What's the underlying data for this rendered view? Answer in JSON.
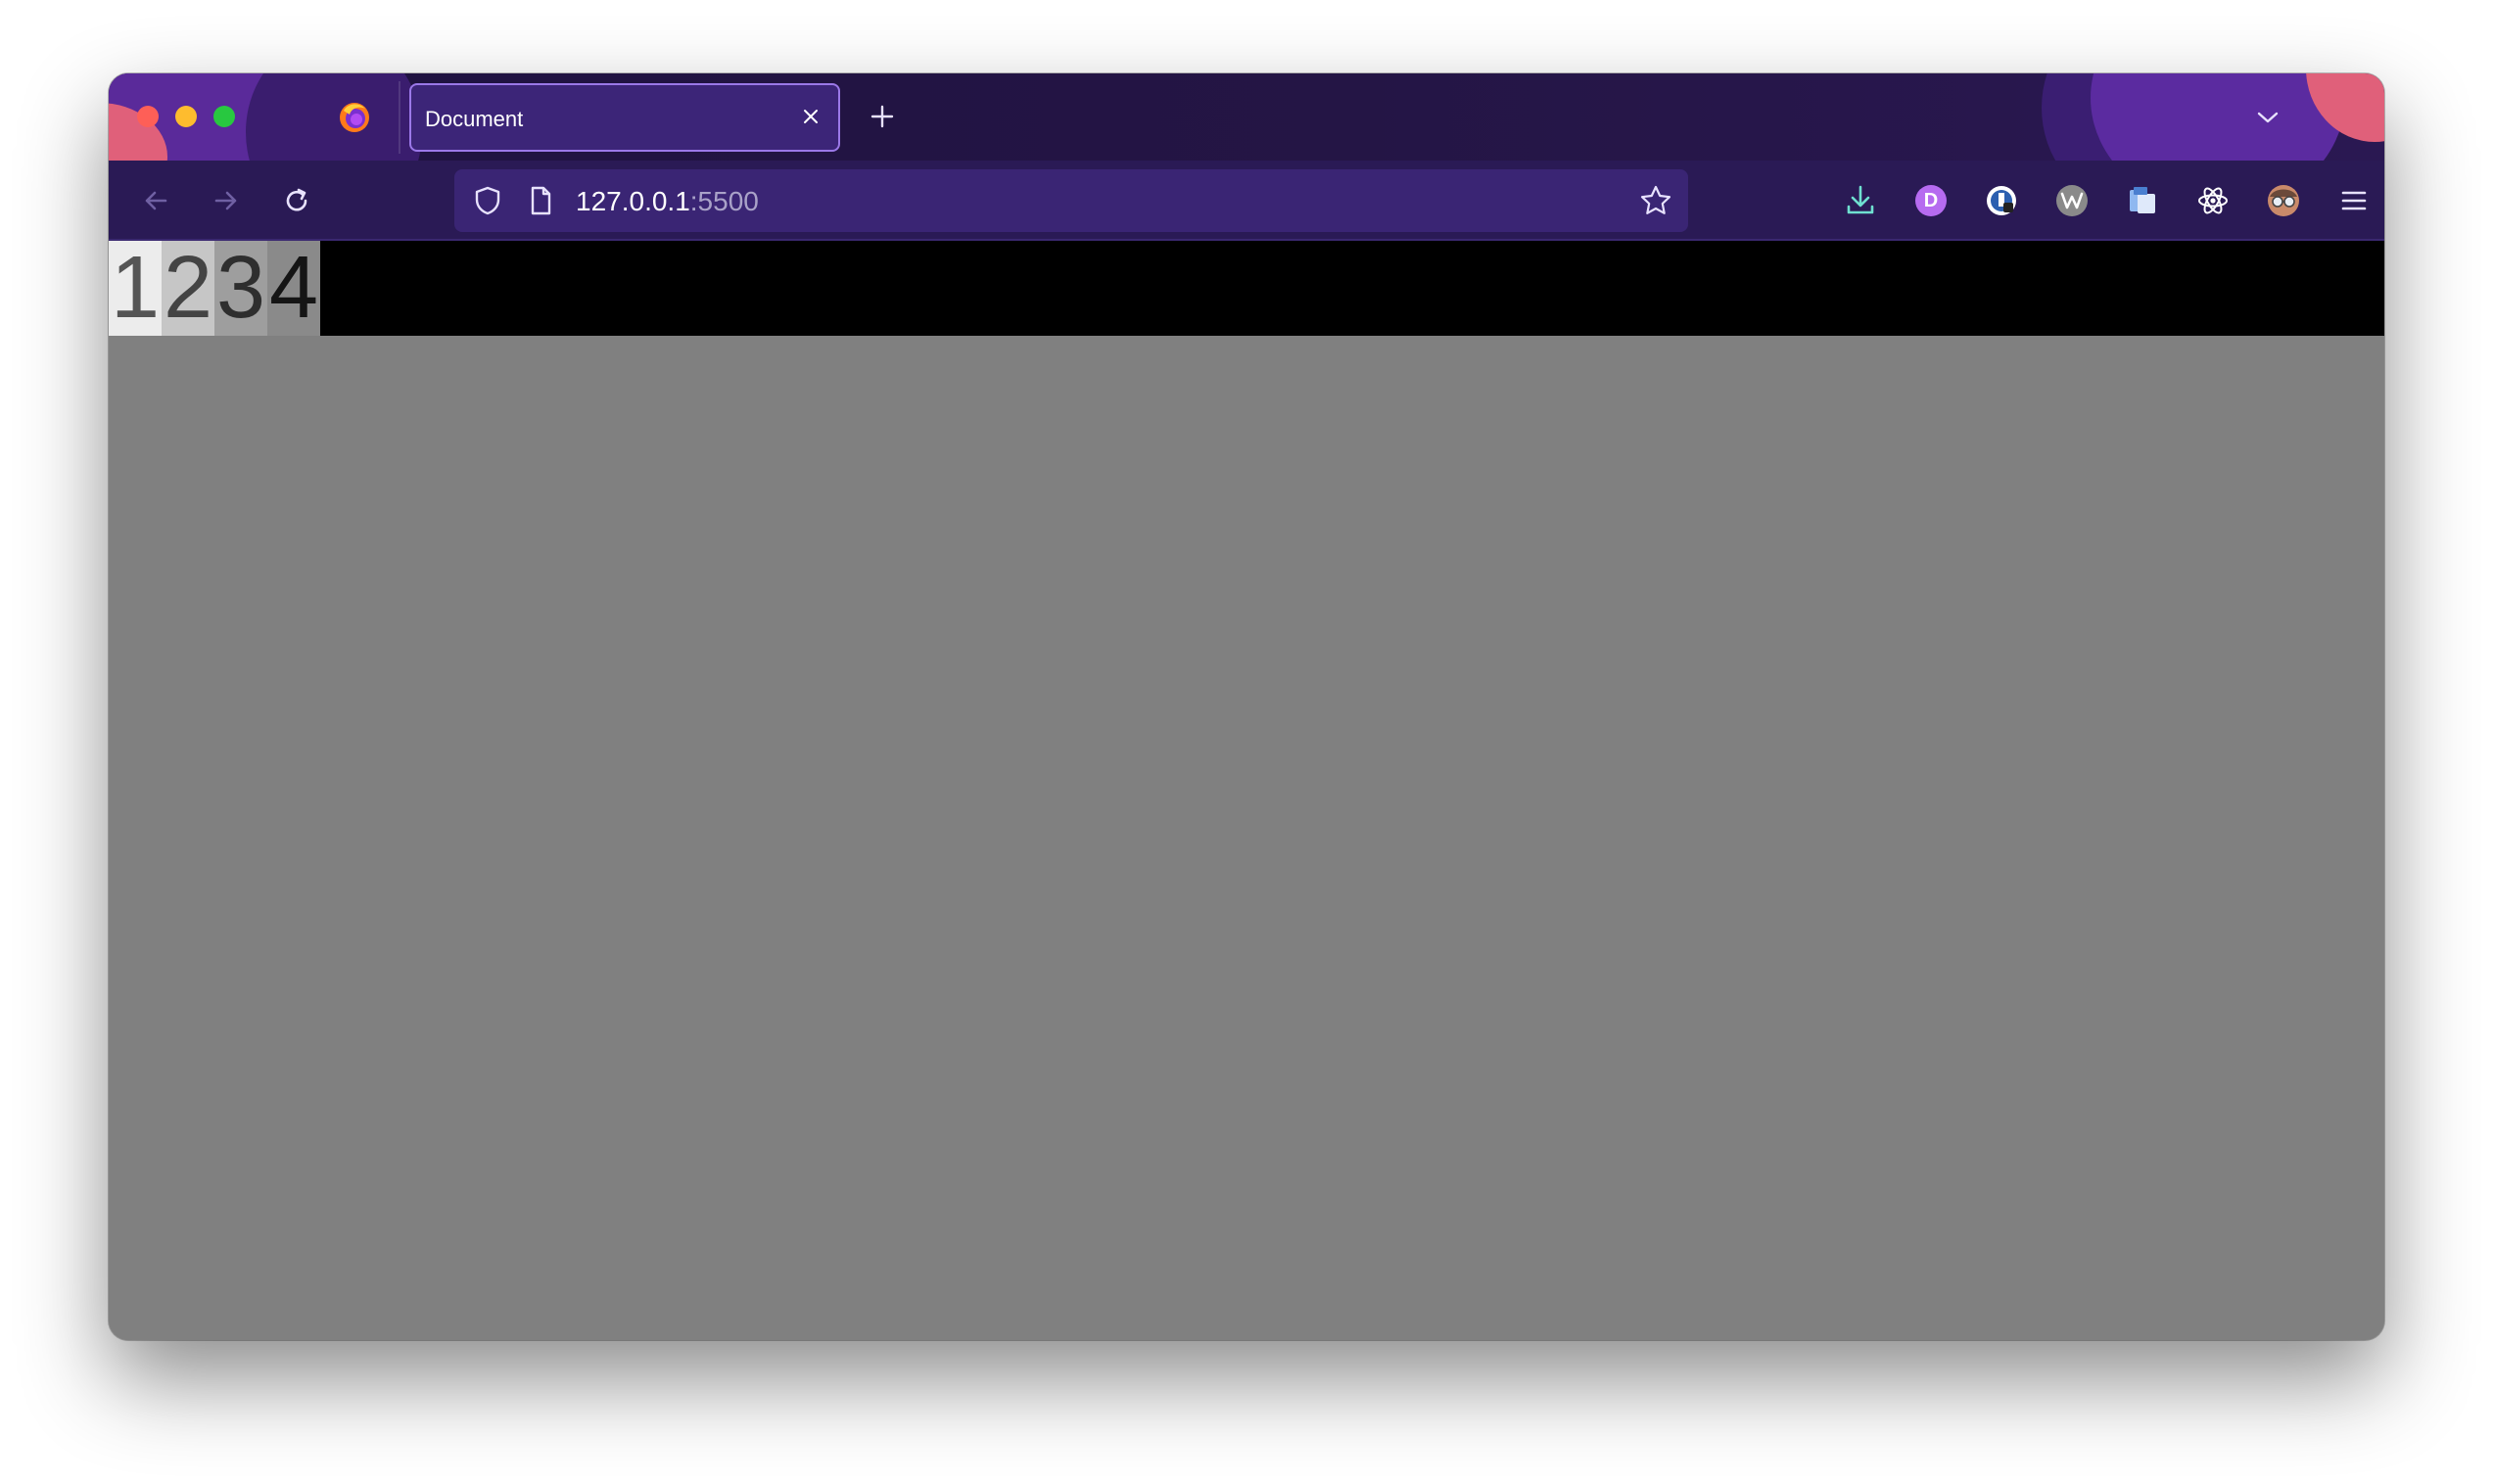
{
  "tab": {
    "title": "Document"
  },
  "urlbar": {
    "host": "127.0.0.1",
    "port": ":5500"
  },
  "icons": {
    "firefox": "firefox-logo-icon",
    "tab_close": "close-icon",
    "new_tab": "plus-icon",
    "tab_list": "chevron-down-icon",
    "back": "arrow-left-icon",
    "forward": "arrow-right-icon",
    "reload": "reload-icon",
    "tracking_protection": "shield-icon",
    "page_info": "page-icon",
    "bookmark": "star-icon",
    "downloads": "download-icon",
    "extension_d": "extension-d-icon",
    "extension_2": "extension-badge-icon",
    "extension_3": "extension-wave-icon",
    "extension_4": "extension-cards-icon",
    "extension_react": "react-atom-icon",
    "extension_avatar": "glasses-avatar-icon",
    "menu": "hamburger-menu-icon"
  },
  "extensions": {
    "d_letter": "D"
  },
  "page": {
    "cells": [
      "1",
      "2",
      "3",
      "4"
    ]
  },
  "colors": {
    "tabstrip_bg": "#1f1240",
    "navbar_bg": "#2a1a55",
    "urlbar_bg": "#3a2574",
    "tab_border": "#9b78e8",
    "page_bg": "#808080",
    "bar_bg": "#000000",
    "cell_1_bg": "#ececec",
    "cell_2_bg": "#c6c6c6",
    "cell_3_bg": "#9e9e9e",
    "cell_4_bg": "#8a8a8a"
  }
}
